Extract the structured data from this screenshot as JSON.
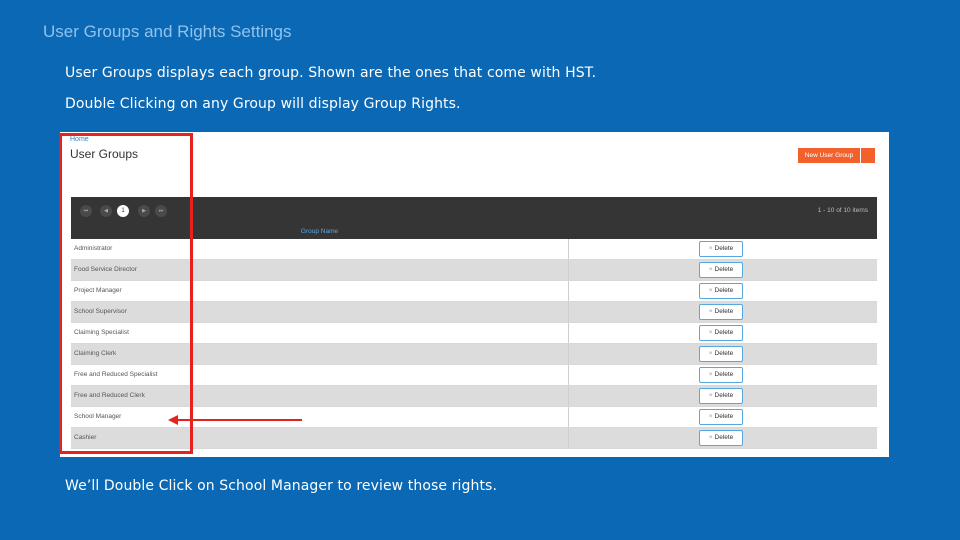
{
  "slide": {
    "title": "User Groups and Rights Settings",
    "caption_1": "User Groups displays each group. Shown are the ones that come with HST.",
    "caption_2": "Double Clicking on any  Group will display Group Rights.",
    "caption_3": "We’ll Double Click on School Manager to review those rights.",
    "colors": {
      "background": "#0a68b4",
      "highlight": "#e42320",
      "accent": "#f2612b"
    }
  },
  "app": {
    "breadcrumb": "Home",
    "page_title": "User Groups",
    "new_button": "New User Group",
    "pager": {
      "first": "⏮",
      "prev": "◀",
      "current": "1",
      "next": "▶",
      "last": "⏭",
      "info": "1 - 10 of 10 items"
    },
    "column_header": "Group Name",
    "delete_label": "Delete",
    "groups": [
      "Administrator",
      "Food Service Director",
      "Project Manager",
      "School Supervisor",
      "Claiming Specialist",
      "Claiming Clerk",
      "Free and Reduced Specialist",
      "Free and Reduced Clerk",
      "School Manager",
      "Cashier"
    ]
  }
}
